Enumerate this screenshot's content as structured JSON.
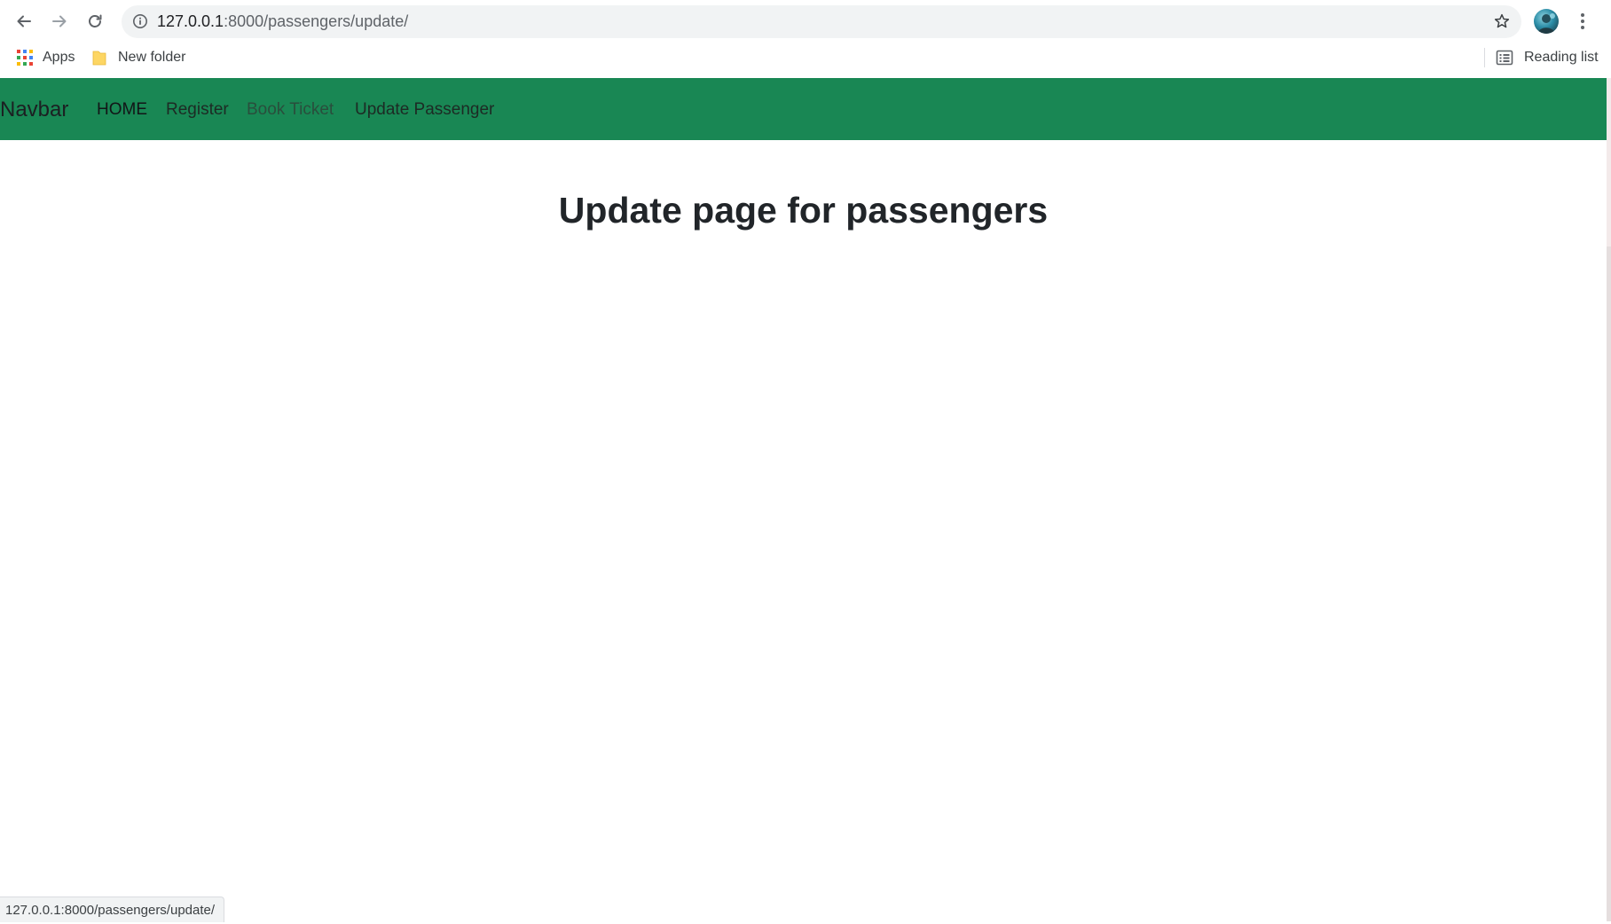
{
  "browser": {
    "url_host": "127.0.0.1",
    "url_path": ":8000/passengers/update/",
    "bookmarks": {
      "apps": "Apps",
      "folder": "New folder",
      "reading_list": "Reading list"
    },
    "status_url": "127.0.0.1:8000/passengers/update/"
  },
  "navbar": {
    "brand": "Navbar",
    "links": [
      {
        "label": "HOME",
        "icon": null
      },
      {
        "label": "Register"
      },
      {
        "label": "Book Ticket"
      },
      {
        "label": "Update Passenger"
      }
    ],
    "color": "#198754"
  },
  "main": {
    "title": "Update page for passengers"
  },
  "icons": {
    "back": "arrow-left-icon",
    "forward": "arrow-right-icon",
    "reload": "reload-icon",
    "info": "info-icon",
    "star": "star-icon",
    "menu": "more-vert-icon",
    "apps": "apps-grid-icon",
    "folder": "folder-icon",
    "reading_list": "reading-list-icon"
  }
}
